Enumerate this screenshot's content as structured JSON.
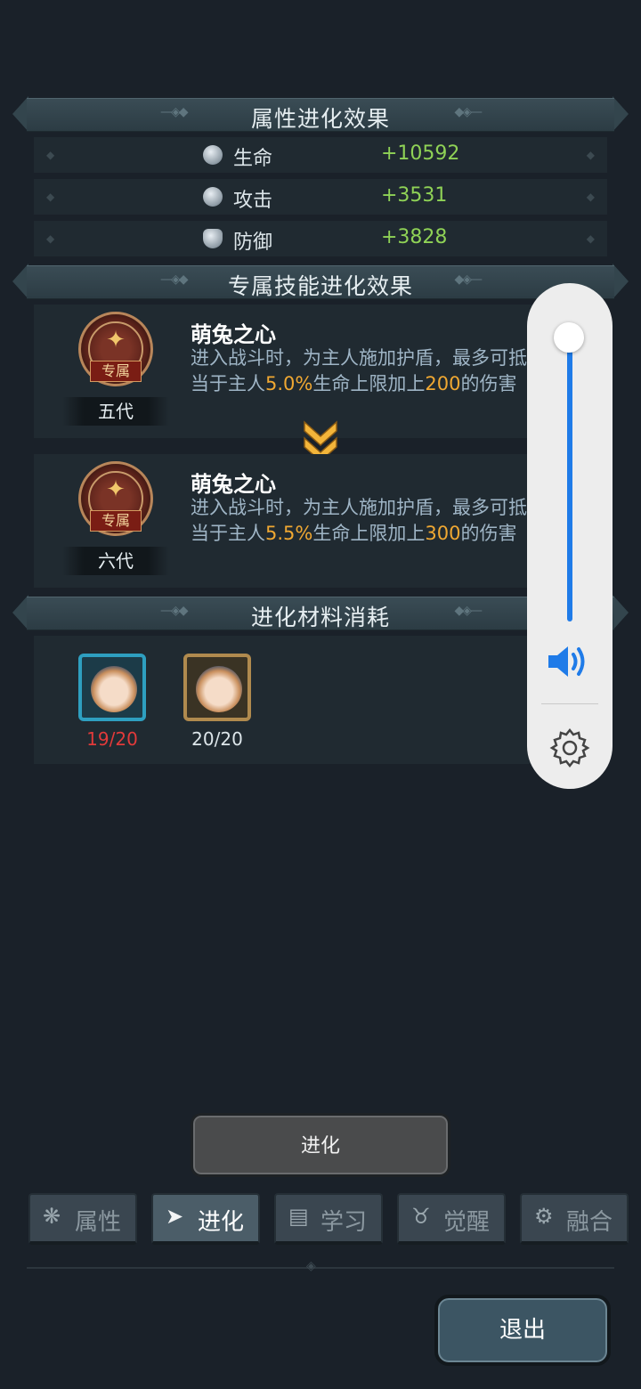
{
  "attr_section": {
    "title": "属性进化效果"
  },
  "stats": [
    {
      "icon": "heart-gem-icon",
      "name": "生命",
      "value": "+10592"
    },
    {
      "icon": "sword-gem-icon",
      "name": "攻击",
      "value": "+3531"
    },
    {
      "icon": "shield-icon",
      "name": "防御",
      "value": "+3828"
    }
  ],
  "skill_section": {
    "title": "专属技能进化效果"
  },
  "skills": [
    {
      "badge": "专属",
      "generation": "五代",
      "name": "萌兔之心",
      "desc_1": "进入战斗时，为主人施加护盾，最多可抵挡相",
      "desc_2a": "当于主人",
      "pct": "5.0%",
      "desc_2b": "生命上限加上",
      "amount": "200",
      "desc_2c": "的伤害"
    },
    {
      "badge": "专属",
      "generation": "六代",
      "name": "萌兔之心",
      "desc_1": "进入战斗时，为主人施加护盾，最多可抵挡相",
      "desc_2a": "当于主人",
      "pct": "5.5%",
      "desc_2b": "生命上限加上",
      "amount": "300",
      "desc_2c": "的伤害"
    }
  ],
  "material_section": {
    "title": "进化材料消耗"
  },
  "materials": [
    {
      "count": "19/20",
      "status_color": "#e23a3a",
      "frame_color": "#2e9fc0"
    },
    {
      "count": "20/20",
      "status_color": "#dde6ea",
      "frame_color": "#b08a4e"
    }
  ],
  "evolve_button": "进化",
  "tabs": [
    {
      "icon": "paw-icon",
      "label": "属性",
      "active": false
    },
    {
      "icon": "arrow-up-icon",
      "label": "进化",
      "active": true
    },
    {
      "icon": "book-icon",
      "label": "学习",
      "active": false
    },
    {
      "icon": "beast-head-icon",
      "label": "觉醒",
      "active": false
    },
    {
      "icon": "fusion-icon",
      "label": "融合",
      "active": false
    }
  ],
  "exit_button": "退出",
  "volume": {
    "level_fraction": 1.0,
    "accent": "#1f7be8"
  }
}
